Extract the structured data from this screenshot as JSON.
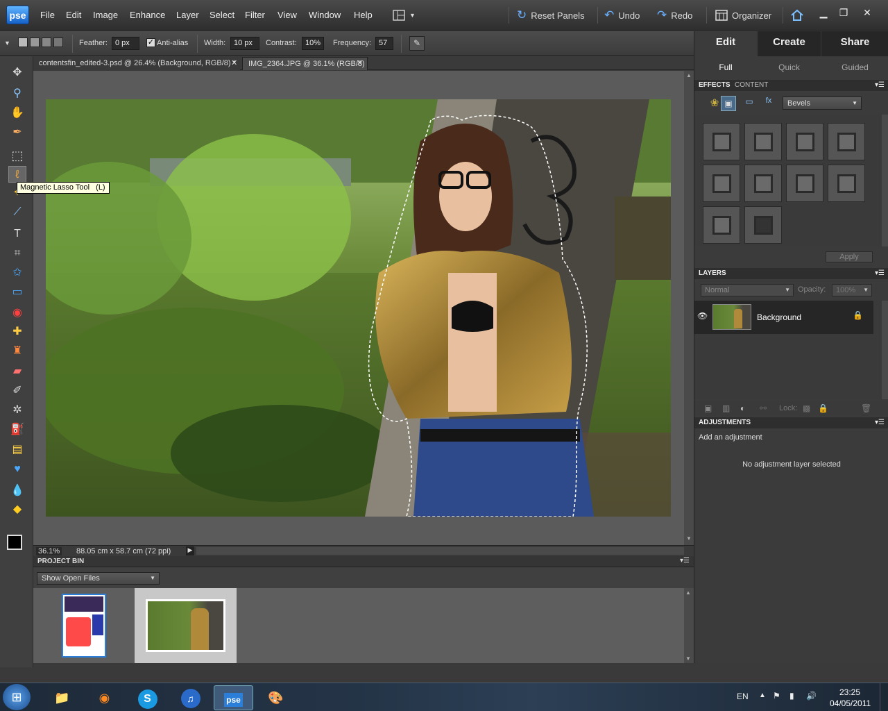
{
  "app": {
    "logo": "pse"
  },
  "menu": [
    "File",
    "Edit",
    "Image",
    "Enhance",
    "Layer",
    "Select",
    "Filter",
    "View",
    "Window",
    "Help"
  ],
  "toolbar": {
    "reset_panels": "Reset Panels",
    "undo": "Undo",
    "redo": "Redo",
    "organizer": "Organizer"
  },
  "options": {
    "feather_label": "Feather:",
    "feather_value": "0 px",
    "antialias_label": "Anti-alias",
    "antialias_checked": true,
    "width_label": "Width:",
    "width_value": "10 px",
    "contrast_label": "Contrast:",
    "contrast_value": "10%",
    "frequency_label": "Frequency:",
    "frequency_value": "57"
  },
  "tooltip": {
    "text": "Magnetic Lasso Tool",
    "shortcut": "(L)"
  },
  "doc_tabs": [
    {
      "label": "contentsfin_edited-3.psd @ 26.4% (Background, RGB/8) *",
      "active": false
    },
    {
      "label": "IMG_2364.JPG @ 36.1% (RGB/8)",
      "active": true
    }
  ],
  "status": {
    "zoom": "36.1%",
    "doc_size": "88.05 cm x 58.7 cm (72 ppi)"
  },
  "project_bin": {
    "title": "PROJECT BIN",
    "dropdown": "Show Open Files"
  },
  "right_panel": {
    "modes": [
      "Edit",
      "Create",
      "Share"
    ],
    "sub_modes": [
      "Full",
      "Quick",
      "Guided"
    ],
    "effects_tab": "EFFECTS",
    "content_tab": "CONTENT",
    "effects_dropdown": "Bevels",
    "apply_label": "Apply",
    "layers_title": "LAYERS",
    "blend_mode": "Normal",
    "opacity_label": "Opacity:",
    "opacity_value": "100%",
    "layer_name": "Background",
    "lock_label": "Lock:",
    "adjustments_title": "ADJUSTMENTS",
    "add_adjustment": "Add an adjustment",
    "no_adjustment": "No adjustment layer selected"
  },
  "taskbar": {
    "lang": "EN",
    "time": "23:25",
    "date": "04/05/2011",
    "pse_label": "pse"
  },
  "colors": {
    "accent": "#2b7fd8",
    "panel_bg": "#3b3b3b",
    "canvas_bg": "#5b5b5b"
  }
}
